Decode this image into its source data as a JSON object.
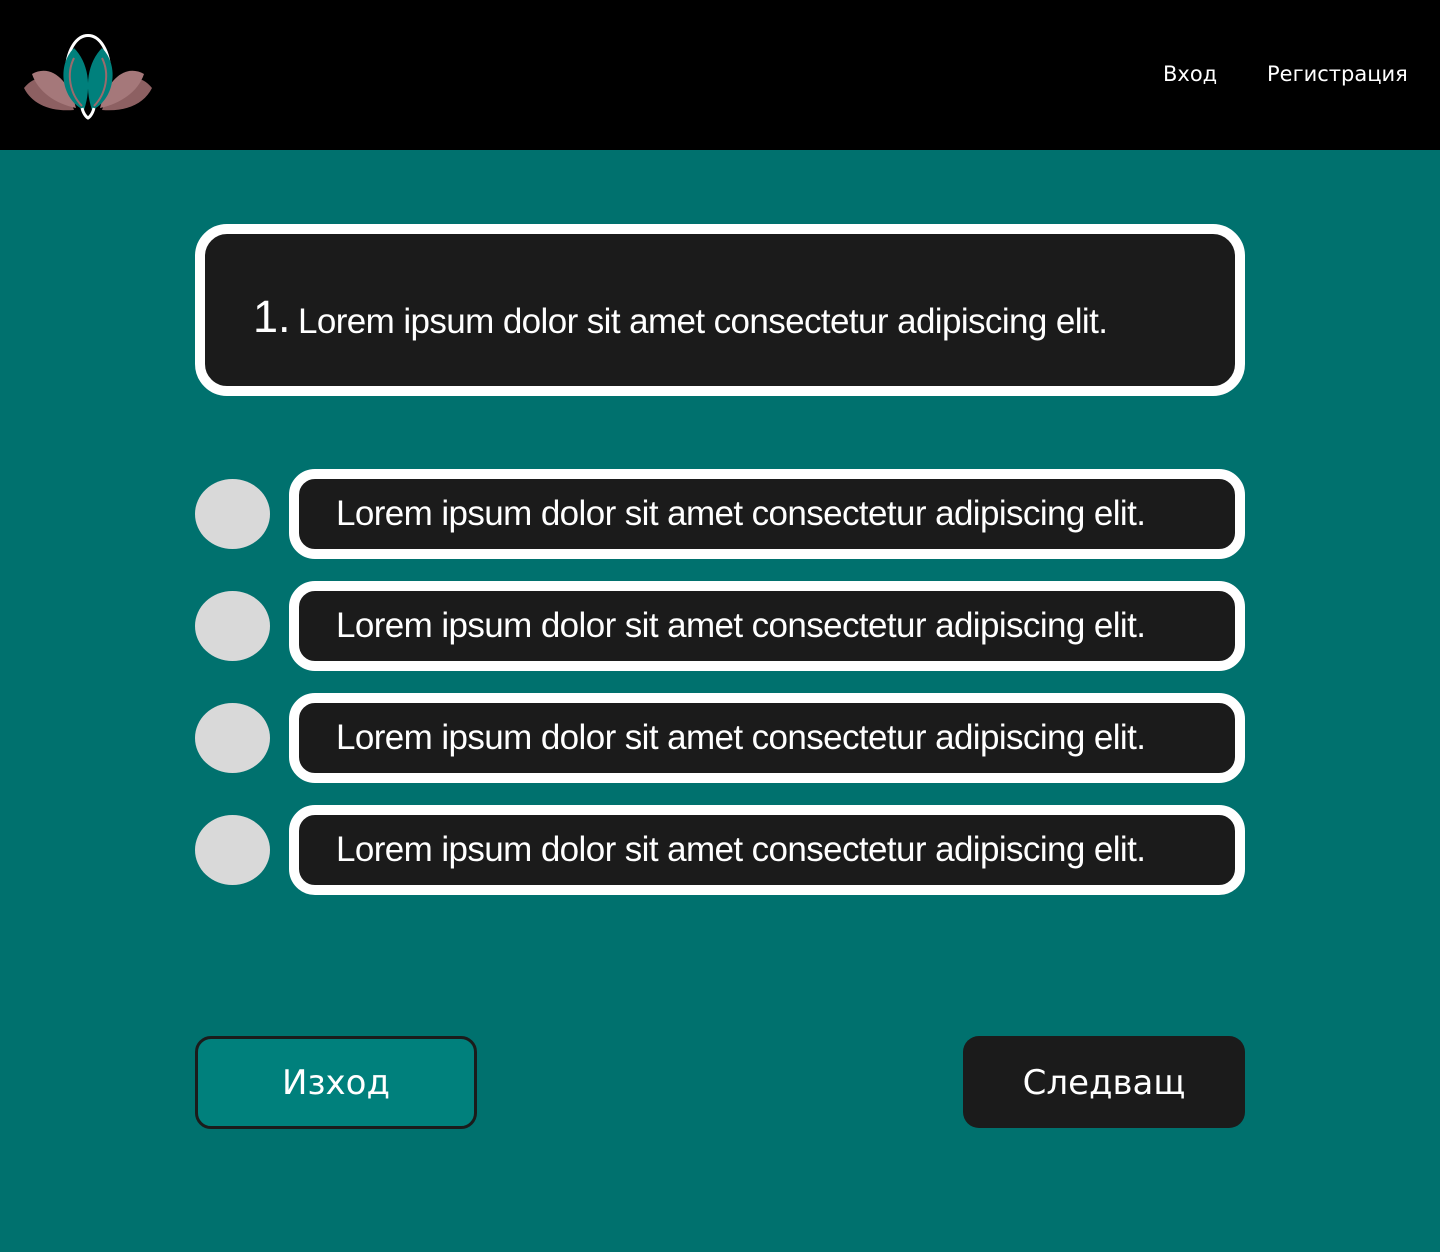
{
  "header": {
    "logo_icon": "lotus-headphones-logo-icon",
    "nav": {
      "login_label": "Вход",
      "register_label": "Регистрация"
    }
  },
  "question": {
    "number": "1.",
    "text": "Lorem ipsum dolor sit amet consectetur adipiscing elit."
  },
  "answers": [
    {
      "text": "Lorem ipsum dolor sit amet consectetur adipiscing elit."
    },
    {
      "text": "Lorem ipsum dolor sit amet consectetur adipiscing elit."
    },
    {
      "text": "Lorem ipsum dolor sit amet consectetur adipiscing elit."
    },
    {
      "text": "Lorem ipsum dolor sit amet consectetur adipiscing elit."
    }
  ],
  "buttons": {
    "exit_label": "Изход",
    "next_label": "Следващ"
  },
  "colors": {
    "page_background": "#00716e",
    "header_background": "#000000",
    "box_background": "#1b1b1b",
    "box_border": "#ffffff",
    "radio_fill": "#d9d9d9",
    "exit_button_fill": "#00807c",
    "logo_teal": "#00807c",
    "logo_rose": "#9b6a6c"
  }
}
